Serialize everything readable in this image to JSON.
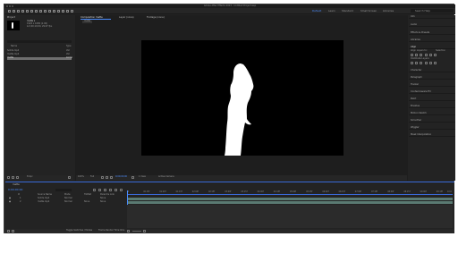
{
  "window": {
    "title": "Adobe After Effects 2023 - Untitled Project.aep"
  },
  "workspaces": [
    {
      "label": "Default",
      "active": true
    },
    {
      "label": "Learn",
      "active": false
    },
    {
      "label": "Standard",
      "active": false
    },
    {
      "label": "Small Screen",
      "active": false
    },
    {
      "label": "Libraries",
      "active": false
    }
  ],
  "search_help": {
    "placeholder": "Search Help"
  },
  "project": {
    "tab": "Project",
    "item_name": "matte ▾",
    "item_info_1": "1920 x 1080 (1.00)",
    "item_info_2": "Δ 0;00;10;00, 29.97 fps",
    "search_placeholder": "",
    "col_name": "Name",
    "col_type": "Type",
    "rows": [
      {
        "name": "Solids.mp4",
        "type": "AVI"
      },
      {
        "name": "matte.mp4",
        "type": "AVI"
      },
      {
        "name": "matte",
        "type": "Comp"
      }
    ],
    "footer_bpc": "8 bpc"
  },
  "comp_tabs": {
    "active": "Composition matte",
    "second": "Layer (none)",
    "third": "Footage (none)",
    "breadcrumb": "matte"
  },
  "viewer_bar": {
    "zoom": "100%",
    "quality": "Full",
    "timecode": "0;00;00;00",
    "view": "1 View",
    "camera": "Active Camera"
  },
  "right_panel": {
    "tabs": [
      "Info",
      "Audio",
      "Effects & Presets",
      "Libraries"
    ],
    "align_title": "Align",
    "align_to_label": "Align Layers to:",
    "align_to_value": "Selection",
    "distribute_label": "Distribute Layers:",
    "sections": [
      "Character",
      "Paragraph",
      "Tracker",
      "Content-Aware Fill",
      "Paint",
      "Brushes",
      "Motion Sketch",
      "Smoother",
      "Wiggler",
      "Mask Interpolation"
    ]
  },
  "timeline": {
    "tab": "matte",
    "timecode": "0;00;00;00",
    "col_source": "Source Name",
    "col_mode": "Mode",
    "col_trkmat": "TrkMat",
    "col_parent": "Parent & Link",
    "layers": [
      {
        "num": "1",
        "name": "Solids.mp4",
        "mode": "Normal",
        "trkmat": "",
        "parent": "None"
      },
      {
        "num": "2",
        "name": "matte.mp4",
        "mode": "Normal",
        "trkmat": "None",
        "parent": "None"
      }
    ],
    "ruler": [
      "0f",
      "00:15f",
      "01:00f",
      "01:15f",
      "02:00f",
      "02:15f",
      "03:00f",
      "03:15f",
      "04:00f",
      "04:15f",
      "05:00f",
      "05:15f",
      "06:00f",
      "06:15f",
      "07:00f",
      "07:15f",
      "08:00f",
      "08:15f",
      "09:00f",
      "09:15f",
      "10:0"
    ],
    "footer_toggle": "Toggle Switches / Modes",
    "footer_render": "Frame Render Time 0ms"
  },
  "colors": {
    "accent": "#4a8cff",
    "bar_green": "#5a7a72",
    "selection": "#6f6f6f"
  }
}
